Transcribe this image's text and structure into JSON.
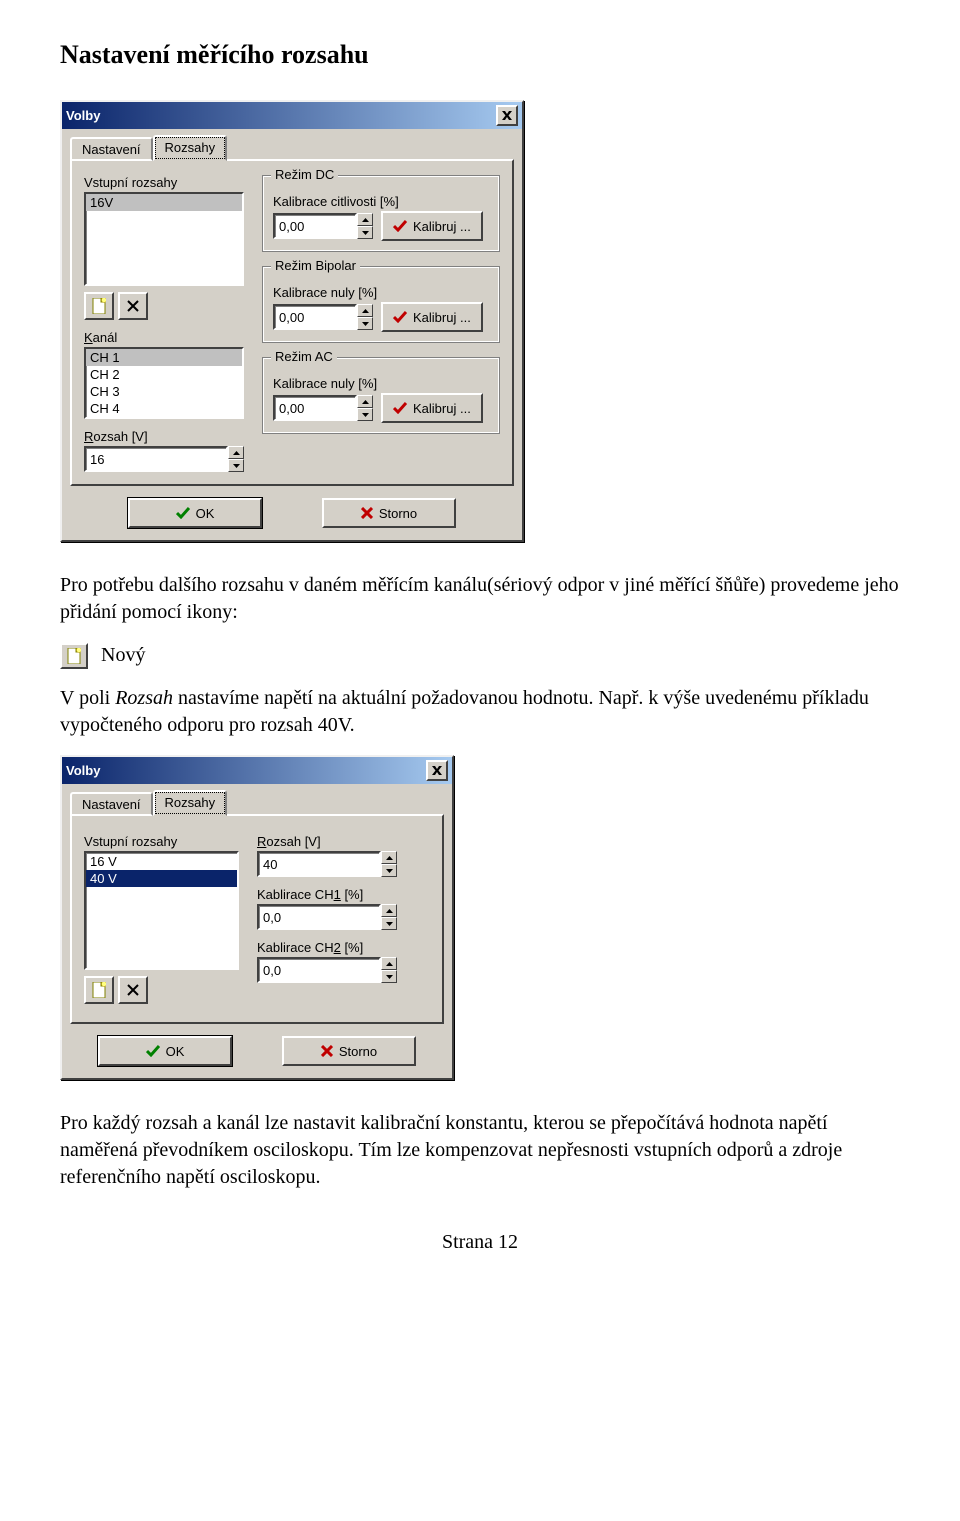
{
  "heading": "Nastavení měřícího rozsahu",
  "para1": "Pro potřebu dalšího rozsahu v daném měřícím kanálu(sériový odpor v jiné měřící šňůře) provedeme jeho přidání pomocí ikony:",
  "new_label": "Nový",
  "para2a": "V poli ",
  "para2b": "Rozsah",
  "para2c": " nastavíme napětí na aktuální požadovanou hodnotu. Např. k výše uvedenému příkladu vypočteného odporu pro rozsah 40V.",
  "para3": "Pro každý rozsah a kanál lze nastavit kalibrační konstantu, kterou se přepočítává hodnota napětí naměřená převodníkem osciloskopu. Tím lze kompenzovat nepřesnosti vstupních odporů a zdroje referenčního napětí osciloskopu.",
  "footer": "Strana 12",
  "dlg1": {
    "title": "Volby",
    "tab1": "Nastavení",
    "tab2": "Rozsahy",
    "vstup_label": "Vstupní rozsahy",
    "vstup_list": [
      "16V"
    ],
    "kanal_label_pre": "K",
    "kanal_label_post": "anál",
    "kanal_list": [
      "CH 1",
      "CH 2",
      "CH 3",
      "CH 4"
    ],
    "rozsah_label_pre": "R",
    "rozsah_label_post": "ozsah [V]",
    "rozsah_value": "16",
    "group_dc": "Režim DC",
    "group_bp": "Režim Bipolar",
    "group_ac": "Režim AC",
    "cal_sens": "Kalibrace citlivosti [%]",
    "cal_zero": "Kalibrace nuly [%]",
    "cal_value": "0,00",
    "btn_kalibruj": "Kalibruj ...",
    "btn_ok": "OK",
    "btn_storno": "Storno"
  },
  "dlg2": {
    "title": "Volby",
    "tab1": "Nastavení",
    "tab2": "Rozsahy",
    "vstup_label": "Vstupní rozsahy",
    "vstup_list": [
      "16 V",
      "40 V"
    ],
    "rozsah_label_pre": "R",
    "rozsah_label_post": "ozsah [V]",
    "rozsah_value": "40",
    "cal1_label_a": "Kablirace CH",
    "cal1_label_b": "1",
    "cal1_label_c": " [%]",
    "cal1_value": "0,0",
    "cal2_label_a": "Kablirace CH",
    "cal2_label_b": "2",
    "cal2_label_c": " [%]",
    "cal2_value": "0,0",
    "btn_ok": "OK",
    "btn_storno": "Storno"
  }
}
